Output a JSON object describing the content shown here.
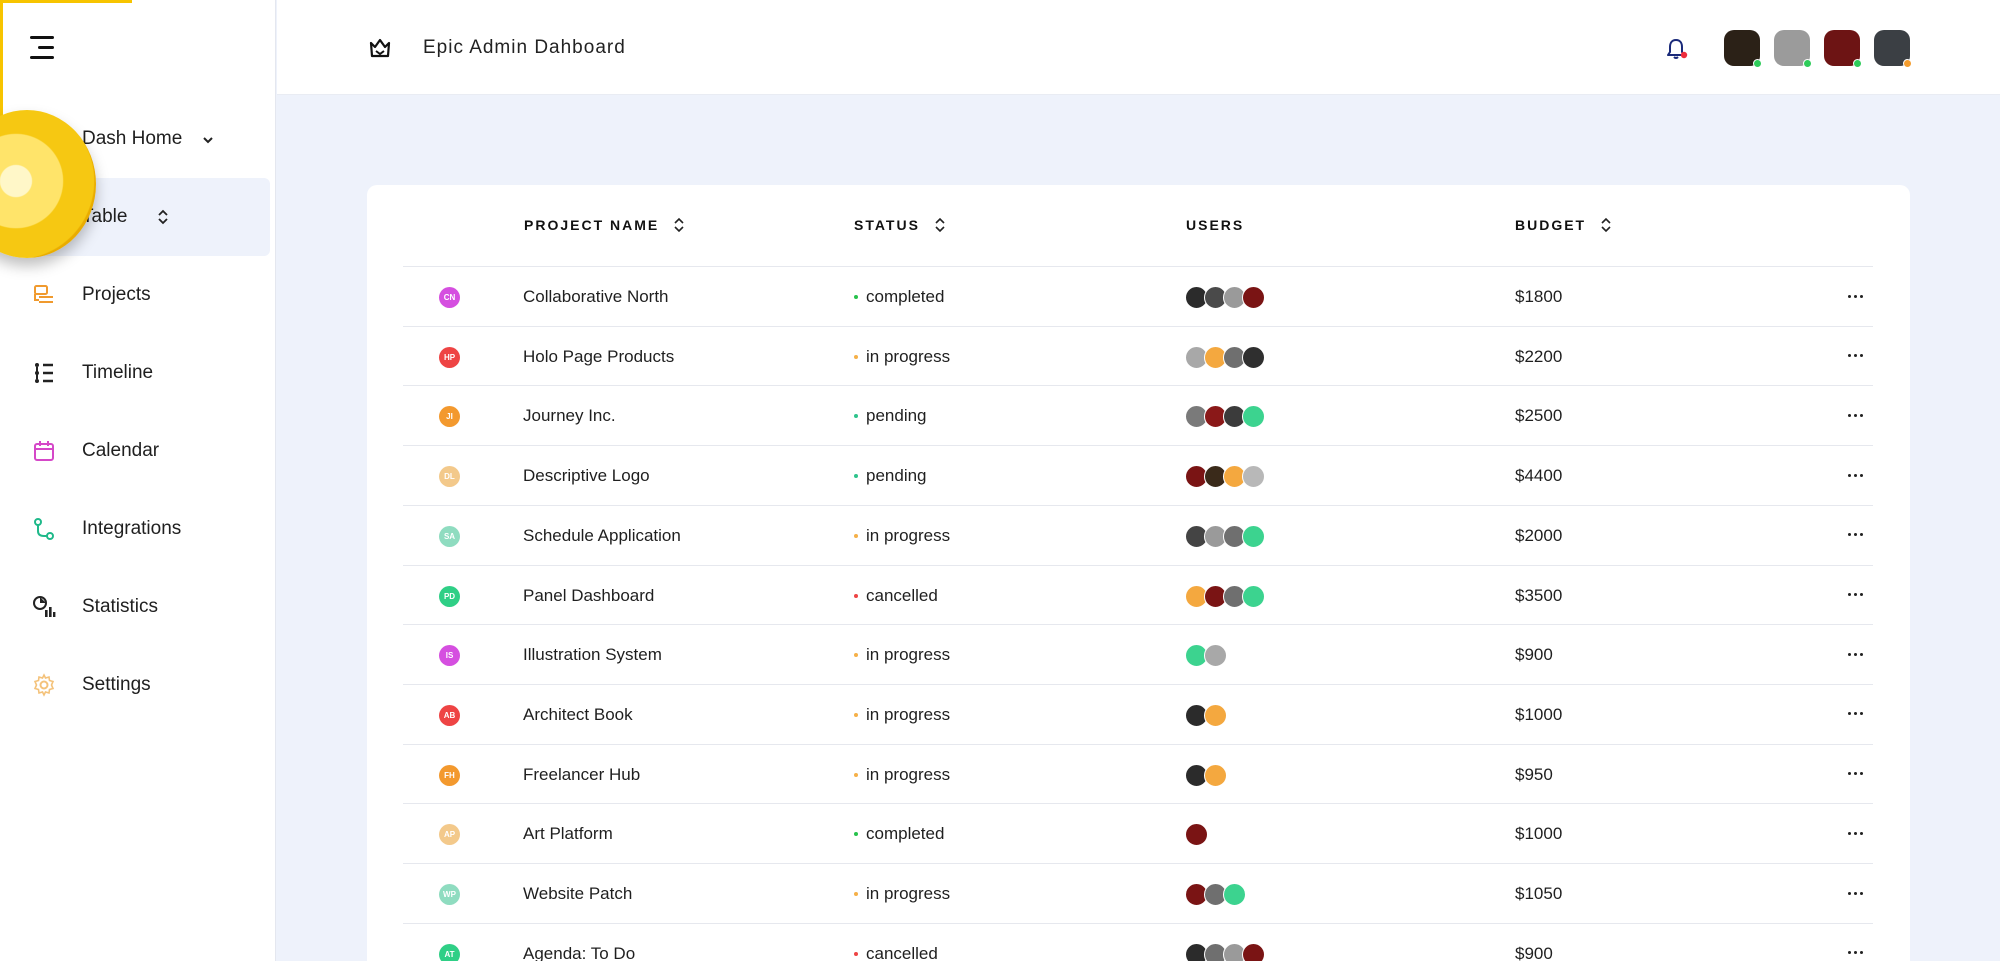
{
  "header": {
    "title": "Epic Admin Dahboard"
  },
  "sidebar": {
    "items": [
      {
        "name": "dash-home",
        "label": "Dash Home",
        "icon": "home-icon",
        "caret": "chevron-down"
      },
      {
        "name": "table",
        "label": "Table",
        "icon": "table-icon",
        "caret": "sort",
        "active": true
      },
      {
        "name": "projects",
        "label": "Projects",
        "icon": "projects-icon",
        "color": "#f09a2e"
      },
      {
        "name": "timeline",
        "label": "Timeline",
        "icon": "timeline-icon",
        "color": "#222222"
      },
      {
        "name": "calendar",
        "label": "Calendar",
        "icon": "calendar-icon",
        "color": "#d548c8"
      },
      {
        "name": "integrations",
        "label": "Integrations",
        "icon": "integrations-icon",
        "color": "#1fb98a"
      },
      {
        "name": "statistics",
        "label": "Statistics",
        "icon": "statistics-icon",
        "color": "#222222"
      },
      {
        "name": "settings",
        "label": "Settings",
        "icon": "gear-icon",
        "color": "#f4c27a"
      }
    ]
  },
  "table": {
    "columns": {
      "project": "PROJECT NAME",
      "status": "STATUS",
      "users": "USERS",
      "budget": "BUDGET"
    },
    "rows": [
      {
        "initials": "CN",
        "color": "#d54fe0",
        "name": "Collaborative North",
        "status": "completed",
        "status_color": "#27c24c",
        "users": [
          "#2b2b2b",
          "#4a4a4a",
          "#9a9a9a",
          "#7a1414"
        ],
        "budget": "$1800"
      },
      {
        "initials": "HP",
        "color": "#ee4444",
        "name": "Holo Page Products",
        "status": "in progress",
        "status_color": "#f5b048",
        "users": [
          "#a8a8a8",
          "#f4a83f",
          "#6f6f6f",
          "#2f2f2f"
        ],
        "budget": "$2200"
      },
      {
        "initials": "JI",
        "color": "#f3992e",
        "name": "Journey Inc.",
        "status": "pending",
        "status_color": "#2ec48c",
        "users": [
          "#7a7a7a",
          "#8a1818",
          "#3b3b3b",
          "#3cd38f"
        ],
        "budget": "$2500"
      },
      {
        "initials": "DL",
        "color": "#f3c98b",
        "name": "Descriptive Logo",
        "status": "pending",
        "status_color": "#2ec48c",
        "users": [
          "#7a1414",
          "#3a2a1a",
          "#f4a83f",
          "#b8b8b8"
        ],
        "budget": "$4400"
      },
      {
        "initials": "SA",
        "color": "#8fdcc0",
        "name": "Schedule Application",
        "status": "in progress",
        "status_color": "#f5b048",
        "users": [
          "#444444",
          "#9a9a9a",
          "#6f6f6f",
          "#3cd38f"
        ],
        "budget": "$2000"
      },
      {
        "initials": "PD",
        "color": "#2fcf86",
        "name": "Panel Dashboard",
        "status": "cancelled",
        "status_color": "#ee4444",
        "users": [
          "#f4a83f",
          "#7a1414",
          "#6f6f6f",
          "#3cd38f"
        ],
        "budget": "$3500"
      },
      {
        "initials": "IS",
        "color": "#d54fe0",
        "name": "Illustration System",
        "status": "in progress",
        "status_color": "#f5b048",
        "users": [
          "#3cd38f",
          "#a8a8a8"
        ],
        "budget": "$900"
      },
      {
        "initials": "AB",
        "color": "#ee4444",
        "name": "Architect Book",
        "status": "in progress",
        "status_color": "#f5b048",
        "users": [
          "#2b2b2b",
          "#f4a83f"
        ],
        "budget": "$1000"
      },
      {
        "initials": "FH",
        "color": "#f3992e",
        "name": "Freelancer Hub",
        "status": "in progress",
        "status_color": "#f5b048",
        "users": [
          "#2b2b2b",
          "#f4a83f"
        ],
        "budget": "$950"
      },
      {
        "initials": "AP",
        "color": "#f3c98b",
        "name": "Art Platform",
        "status": "completed",
        "status_color": "#27c24c",
        "users": [
          "#7a1414"
        ],
        "budget": "$1000"
      },
      {
        "initials": "WP",
        "color": "#8fdcc0",
        "name": "Website Patch",
        "status": "in progress",
        "status_color": "#f5b048",
        "users": [
          "#7a1414",
          "#6f6f6f",
          "#3cd38f"
        ],
        "budget": "$1050"
      },
      {
        "initials": "AT",
        "color": "#2fcf86",
        "name": "Agenda: To Do",
        "status": "cancelled",
        "status_color": "#ee4444",
        "users": [
          "#2b2b2b",
          "#6f6f6f",
          "#9a9a9a",
          "#7a1414"
        ],
        "budget": "$900"
      }
    ]
  },
  "header_avatars": [
    {
      "color": "#2b2117",
      "status_color": "#2ecc5a"
    },
    {
      "color": "#9b9b9b",
      "status_color": "#2ecc5a"
    },
    {
      "color": "#6d1414",
      "status_color": "#2ecc5a"
    },
    {
      "color": "#3b3f44",
      "status_color": "#f39c2e"
    }
  ]
}
